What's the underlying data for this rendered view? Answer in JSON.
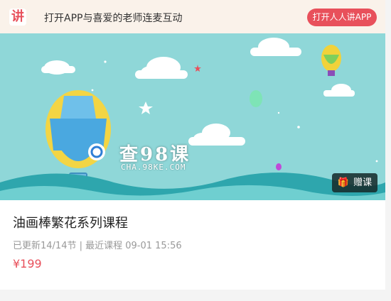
{
  "topbar": {
    "logo_text": "讲",
    "promo_text": "打开APP与喜爱的老师连麦互动",
    "open_app_label": "打开人人讲APP"
  },
  "banner": {
    "watermark_title": "查98课",
    "watermark_url": "CHA.98KE.COM",
    "gift_label": "赠课",
    "gift_icon": "gift-icon"
  },
  "course": {
    "title": "油画棒繁花系列课程",
    "meta": "已更新14/14节 | 最近课程 09-01 15:56",
    "price": "¥199"
  },
  "colors": {
    "accent": "#e8505b",
    "topbar_bg": "#faf2ea",
    "banner_sky": "#8fd7d8"
  }
}
